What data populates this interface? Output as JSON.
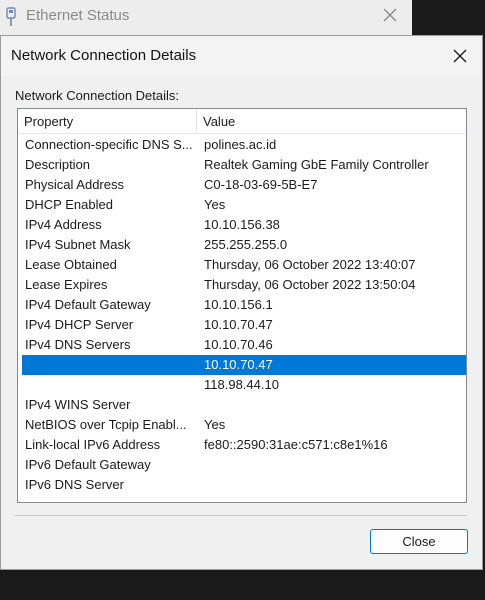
{
  "background_window": {
    "title": "Ethernet Status",
    "close_icon": "close-icon"
  },
  "dialog": {
    "title": "Network Connection Details",
    "close_icon": "close-icon",
    "group_label": "Network Connection Details:",
    "columns": {
      "property": "Property",
      "value": "Value"
    },
    "rows": [
      {
        "property": "Connection-specific DNS S...",
        "value": "polines.ac.id"
      },
      {
        "property": "Description",
        "value": "Realtek Gaming GbE Family Controller"
      },
      {
        "property": "Physical Address",
        "value": "C0-18-03-69-5B-E7"
      },
      {
        "property": "DHCP Enabled",
        "value": "Yes"
      },
      {
        "property": "IPv4 Address",
        "value": "10.10.156.38"
      },
      {
        "property": "IPv4 Subnet Mask",
        "value": "255.255.255.0"
      },
      {
        "property": "Lease Obtained",
        "value": "Thursday, 06 October 2022 13:40:07"
      },
      {
        "property": "Lease Expires",
        "value": "Thursday, 06 October 2022 13:50:04"
      },
      {
        "property": "IPv4 Default Gateway",
        "value": "10.10.156.1"
      },
      {
        "property": "IPv4 DHCP Server",
        "value": "10.10.70.47"
      },
      {
        "property": "IPv4 DNS Servers",
        "value": "10.10.70.46"
      },
      {
        "property": "",
        "value": "10.10.70.47",
        "selected": true
      },
      {
        "property": "",
        "value": "118.98.44.10"
      },
      {
        "property": "IPv4 WINS Server",
        "value": ""
      },
      {
        "property": "NetBIOS over Tcpip Enabl...",
        "value": "Yes"
      },
      {
        "property": "Link-local IPv6 Address",
        "value": "fe80::2590:31ae:c571:c8e1%16"
      },
      {
        "property": "IPv6 Default Gateway",
        "value": ""
      },
      {
        "property": "IPv6 DNS Server",
        "value": ""
      }
    ],
    "close_button_label": "Close"
  },
  "colors": {
    "selection": "#0078d7",
    "dialog_background": "#f0f0f0",
    "list_background": "#ffffff"
  }
}
